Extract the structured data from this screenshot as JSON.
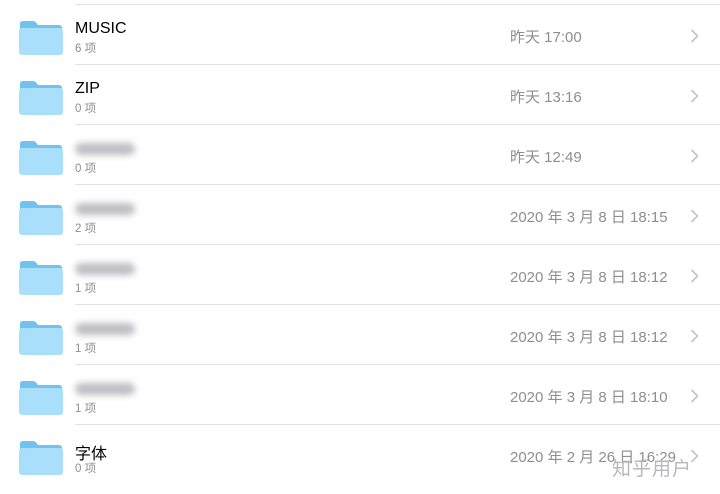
{
  "items": [
    {
      "name": "MUSIC",
      "count": "6 项",
      "date": "昨天 17:00",
      "blurred": false
    },
    {
      "name": "ZIP",
      "count": "0 项",
      "date": "昨天 13:16",
      "blurred": false
    },
    {
      "name": "",
      "count": "0 项",
      "date": "昨天 12:49",
      "blurred": true
    },
    {
      "name": "",
      "count": "2 项",
      "date": "2020 年 3 月 8 日 18:15",
      "blurred": true
    },
    {
      "name": "",
      "count": "1 项",
      "date": "2020 年 3 月 8 日 18:12",
      "blurred": true
    },
    {
      "name": "",
      "count": "1 项",
      "date": "2020 年 3 月 8 日 18:12",
      "blurred": true
    },
    {
      "name": "",
      "count": "1 项",
      "date": "2020 年 3 月 8 日 18:10",
      "blurred": true
    },
    {
      "name": "字体",
      "count": "0 项",
      "date": "2020 年 2 月 26 日 16:29",
      "blurred": false
    }
  ],
  "watermark": "知乎用户",
  "colors": {
    "folder_light": "#a9dffa",
    "folder_dark": "#72c2f0",
    "secondary_text": "#8e8e93",
    "separator": "#e3e3e6"
  },
  "icons": {
    "folder": "folder-icon",
    "chevron": "chevron-right-icon"
  }
}
